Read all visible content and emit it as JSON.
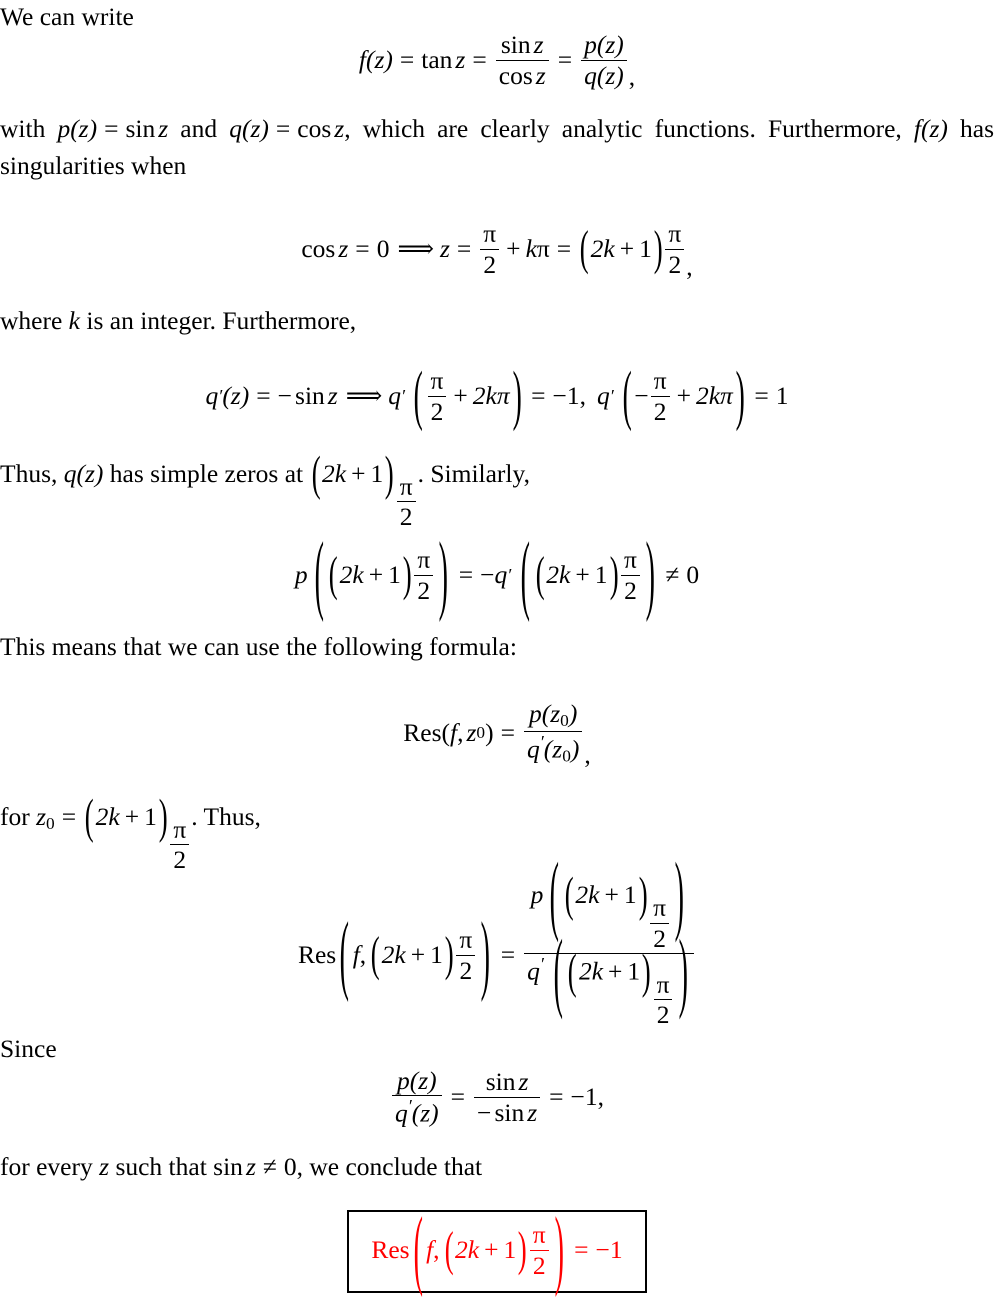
{
  "document": {
    "type": "latex-math-proof",
    "topic": "Residue of f(z) = tan z at its simple poles",
    "text_color": "#000000",
    "highlight_color": "#ff0000",
    "box_border_color": "#000000",
    "background": "#ffffff"
  },
  "blocks": {
    "intro_line": "We can write",
    "eq1": {
      "lhs_f": "f",
      "arg_z": "(z)",
      "eq": "=",
      "tan": "tan",
      "z": "z",
      "eq2": "=",
      "frac1_num_fn": "sin",
      "frac1_num_var": "z",
      "frac1_den_fn": "cos",
      "frac1_den_var": "z",
      "eq3": "=",
      "frac2_num": "p(z)",
      "frac2_den": "q(z)",
      "trailing_comma": ","
    },
    "para_with": {
      "t1": "with",
      "p": "p",
      "pz": "(z)",
      "eq": "=",
      "sin": "sin",
      "z": "z",
      "and": "and",
      "q": "q",
      "qz": "(z)",
      "eq2": "=",
      "cos": "cos",
      "z2": "z",
      "tail": ", which are clearly analytic functions. Furthermore,",
      "f": "f",
      "fz": "(z)",
      "tail2": "has singularities when"
    },
    "eq2": {
      "cos": "cos",
      "z": "z",
      "eq": "=",
      "zero": "0",
      "implies": "⟹",
      "z2": "z",
      "eq2": "=",
      "pi": "π",
      "two": "2",
      "plus": "+",
      "k": "k",
      "kpi": "π",
      "eq3": "=",
      "paren_open": "(",
      "2k": "2k",
      "plus2": "+",
      "one": "1",
      "paren_close": ")",
      "pi2": "π",
      "two2": "2",
      "comma": ","
    },
    "para_where": {
      "t1": "where",
      "k": "k",
      "t2": "is an integer. Furthermore,"
    },
    "eq3": {
      "q": "q",
      "prime": "′",
      "z": "(z)",
      "eq": "=",
      "minus": "−",
      "sin": "sin",
      "zvar": "z",
      "implies": "⟹",
      "q2": "q",
      "prime2": "′",
      "pi": "π",
      "two": "2",
      "plus": "+",
      "twokpi": "2kπ",
      "eq2": "=",
      "minus_one": "−1",
      "comma": ",",
      "q3": "q",
      "prime3": "′",
      "minus2": "−",
      "pi2": "π",
      "two2": "2",
      "plus2": "+",
      "twokpi2": "2kπ",
      "eq3": "=",
      "one": "1"
    },
    "para_thus": {
      "t1": "Thus,",
      "q": "q",
      "qz": "(z)",
      "t2": "has simple zeros at",
      "paren_open": "(",
      "2k": "2k",
      "plus": "+",
      "one": "1",
      "paren_close": ")",
      "pi": "π",
      "two": "2",
      "t3": ". Similarly,"
    },
    "eq4": {
      "p": "p",
      "open": "(",
      "2k": "2k",
      "plus": "+",
      "one": "1",
      "close": ")",
      "pi": "π",
      "two": "2",
      "eq": "=",
      "minus": "−",
      "q": "q",
      "prime": "′",
      "open2": "(",
      "2k2": "2k",
      "plus2": "+",
      "one2": "1",
      "close2": ")",
      "pi2": "π",
      "two2": "2",
      "neq": "≠",
      "zero": "0"
    },
    "para_means": "This means that we can use the following formula:",
    "eq5": {
      "res": "Res",
      "open": "(",
      "f": "f",
      "comma": ",",
      "z": "z",
      "sub": "0",
      "close": ")",
      "eq": "=",
      "num_p": "p",
      "num_open": "(z",
      "num_sub": "0",
      "num_close": ")",
      "den_q": "q",
      "den_prime": "′",
      "den_open": "(z",
      "den_sub": "0",
      "den_close": ")",
      "trailing_comma": ","
    },
    "para_for": {
      "t1": "for",
      "z": "z",
      "sub": "0",
      "eq": "=",
      "open": "(",
      "2k": "2k",
      "plus": "+",
      "one": "1",
      "close": ")",
      "pi": "π",
      "two": "2",
      "t2": ". Thus,"
    },
    "eq6": {
      "res": "Res",
      "open": "(",
      "f": "f",
      "comma": ",",
      "2k": "2k",
      "plus": "+",
      "one": "1",
      "paren_open": "(",
      "paren_close": ")",
      "pi": "π",
      "two": "2",
      "close": ")",
      "eq": "=",
      "num_p": "p",
      "num_open": "(",
      "num_2k": "2k",
      "num_plus": "+",
      "num_one": "1",
      "num_close": ")",
      "num_pi": "π",
      "num_two": "2",
      "den_q": "q",
      "den_prime": "′",
      "den_open": "(",
      "den_2k": "2k",
      "den_plus": "+",
      "den_one": "1",
      "den_close": ")",
      "den_pi": "π",
      "den_two": "2"
    },
    "para_since": "Since",
    "eq7": {
      "num1_p": "p",
      "num1_z": "(z)",
      "den1_q": "q",
      "den1_prime": "′",
      "den1_z": "(z)",
      "eq": "=",
      "num2_sin": "sin",
      "num2_z": "z",
      "den2_minus": "−",
      "den2_sin": "sin",
      "den2_z": "z",
      "eq2": "=",
      "result": "−1",
      "comma": ","
    },
    "para_forevery": {
      "t1": "for every",
      "z": "z",
      "t2": "such that",
      "sin": "sin",
      "z2": "z",
      "neq": "≠",
      "zero": "0",
      "t3": ", we conclude that"
    },
    "boxed": {
      "res": "Res",
      "open": "(",
      "f": "f",
      "comma": ",",
      "paren_open": "(",
      "2k": "2k",
      "plus": "+",
      "one": "1",
      "paren_close": ")",
      "pi": "π",
      "two": "2",
      "close": ")",
      "eq": "=",
      "value": "−1"
    }
  }
}
